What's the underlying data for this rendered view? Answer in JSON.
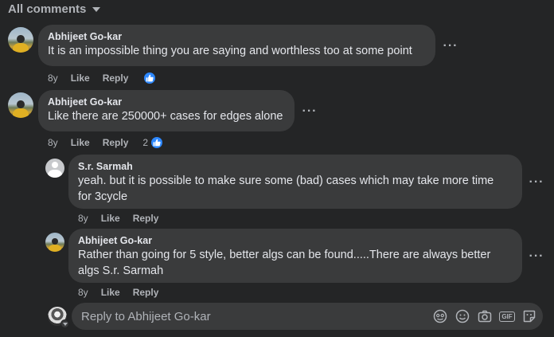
{
  "header": {
    "label": "All comments"
  },
  "comments": [
    {
      "author": "Abhijeet Go-kar",
      "text": "It is an impossible thing you are saying and worthless too at some point",
      "time": "8y",
      "like": "Like",
      "reply": "Reply",
      "reaction_count": ""
    },
    {
      "author": "Abhijeet Go-kar",
      "text": "Like there are 250000+ cases for edges alone",
      "time": "8y",
      "like": "Like",
      "reply": "Reply",
      "reaction_count": "2"
    }
  ],
  "replies": [
    {
      "author": "S.r. Sarmah",
      "text_line1": "yeah. but it is possible to make sure some (bad) cases which may take more time",
      "text_line2": "for 3cycle",
      "time": "8y",
      "like": "Like",
      "reply": "Reply"
    },
    {
      "author": "Abhijeet Go-kar",
      "text_line1": "Rather than going for 5 style, better algs can be found.....There are always better",
      "text_line2": "algs S.r. Sarmah",
      "time": "8y",
      "like": "Like",
      "reply": "Reply"
    }
  ],
  "more_options": "···",
  "reply_box": {
    "placeholder": "Reply to Abhijeet Go-kar"
  },
  "reply_icons": [
    "emoji-icon",
    "smile-icon",
    "camera-icon",
    "gif-icon",
    "sticker-icon"
  ],
  "gif_label": "GIF",
  "colors": {
    "background": "#242526",
    "bubble": "#3a3b3c",
    "accent": "#2d88ff",
    "muted": "#b0b3b8"
  }
}
